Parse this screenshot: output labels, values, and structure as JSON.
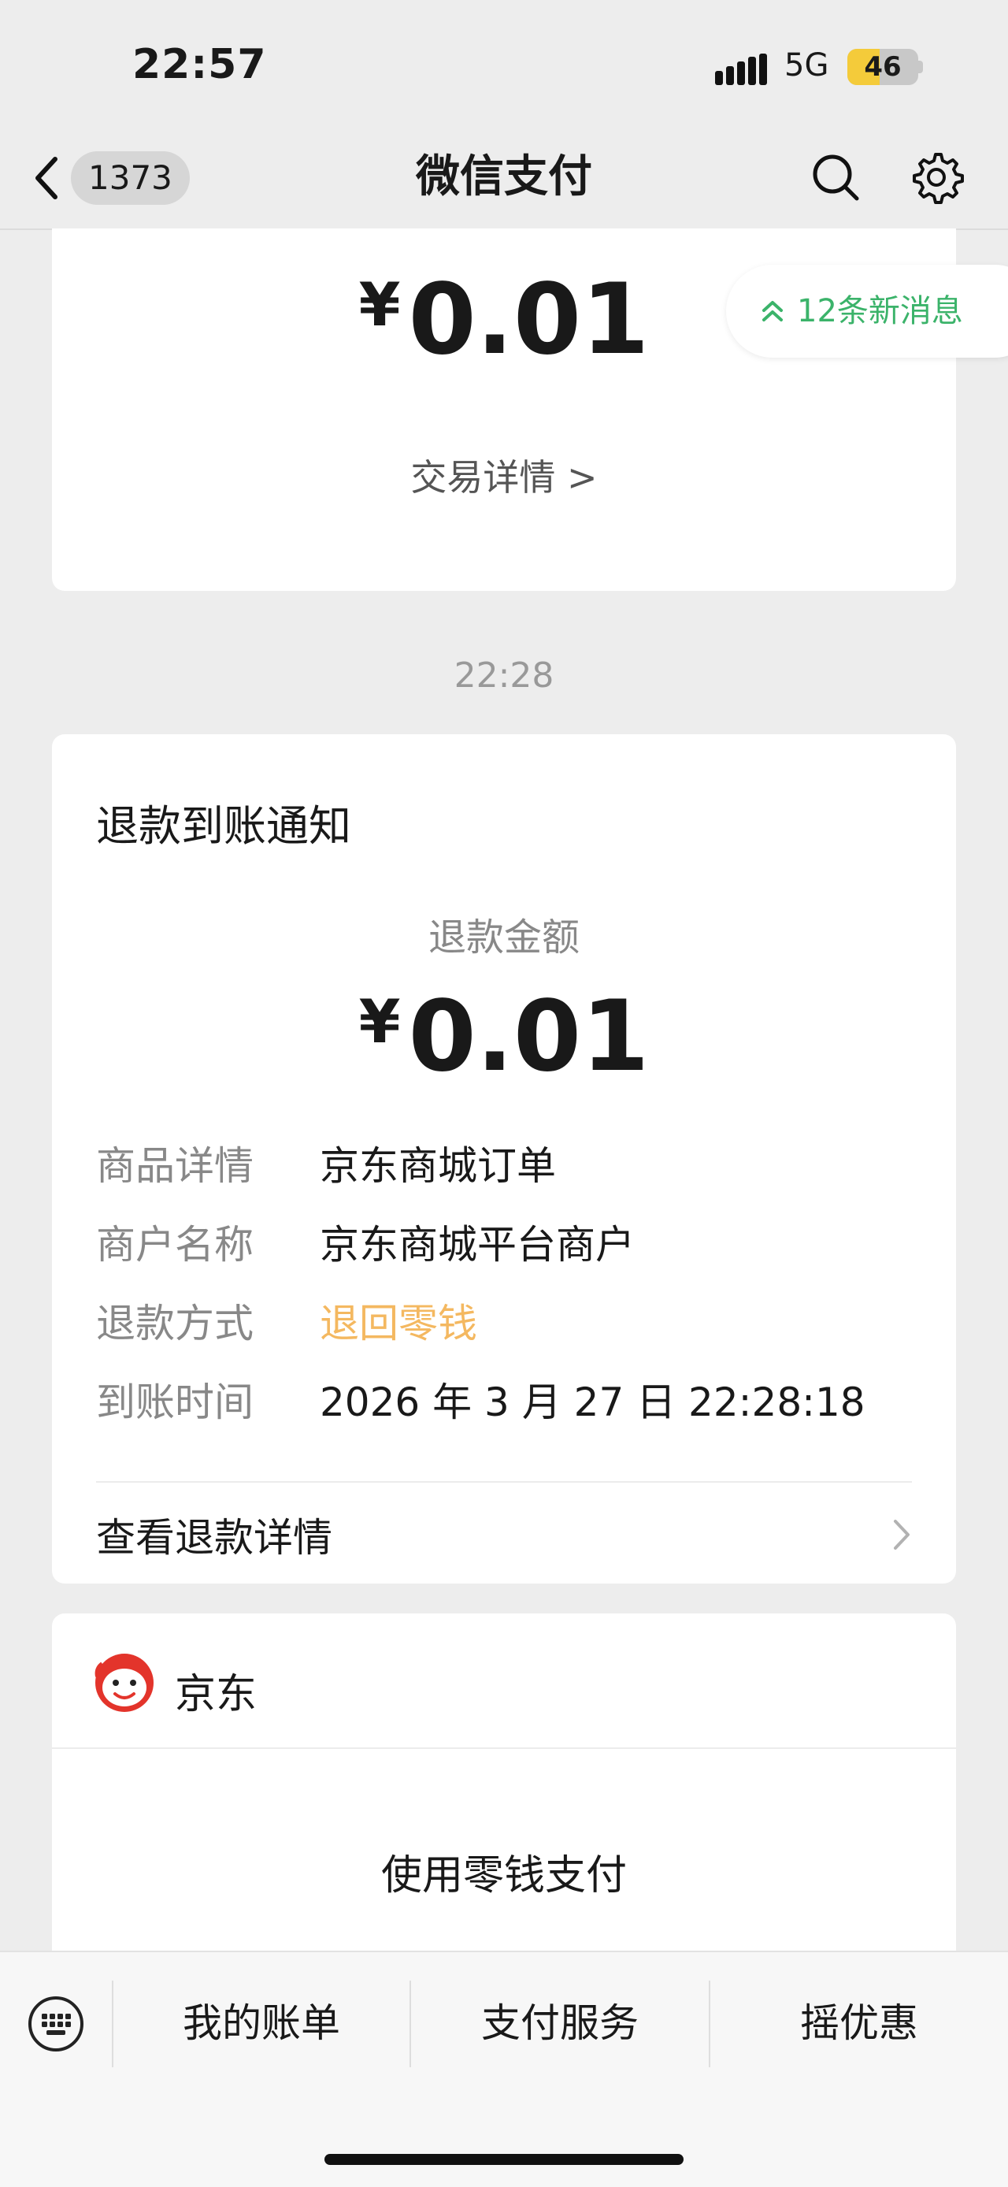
{
  "status_bar": {
    "time": "22:57",
    "network": "5G",
    "battery": "46",
    "battery_fraction": 0.46
  },
  "nav": {
    "back_count": "1373",
    "title": "微信支付",
    "icons": [
      "back-arrow-icon",
      "search-icon",
      "settings-gear-icon"
    ]
  },
  "new_messages": {
    "label": "12条新消息",
    "icon": "double-chevron-up-icon",
    "color": "#3bb36a"
  },
  "prev_card": {
    "currency": "¥",
    "amount": "0.01",
    "link": "交易详情 >"
  },
  "timestamp": "22:28",
  "refund_card": {
    "title": "退款到账通知",
    "amount_label": "退款金额",
    "currency": "¥",
    "amount": "0.01",
    "rows": [
      {
        "key": "商品详情",
        "value": "京东商城订单"
      },
      {
        "key": "商户名称",
        "value": "京东商城平台商户"
      },
      {
        "key": "退款方式",
        "value": "退回零钱"
      },
      {
        "key": "到账时间",
        "value": "2026 年 3 月 27 日 22:28:18"
      }
    ],
    "detail_link": "查看退款详情",
    "accent_color": "#f4b860"
  },
  "merchant_card": {
    "name": "京东",
    "body": "使用零钱支付",
    "logo": "jd-mascot-icon"
  },
  "tab_bar": {
    "items": [
      "我的账单",
      "支付服务",
      "摇优惠"
    ],
    "icon": "keyboard-icon"
  }
}
